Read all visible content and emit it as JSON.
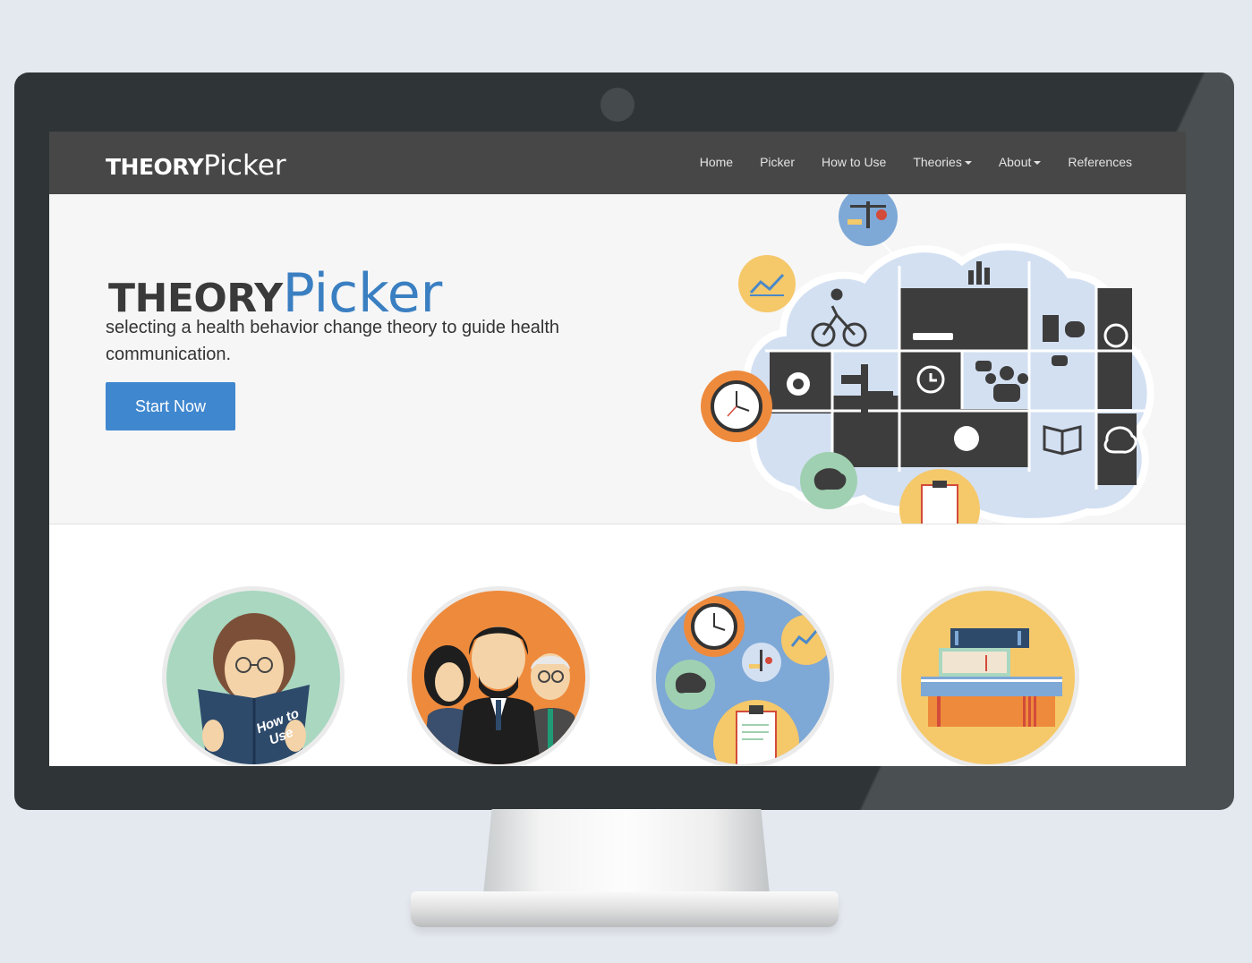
{
  "brand": {
    "part1": "THEORY",
    "part2": "Picker"
  },
  "nav": {
    "items": [
      {
        "label": "Home",
        "dropdown": false
      },
      {
        "label": "Picker",
        "dropdown": false
      },
      {
        "label": "How to Use",
        "dropdown": false
      },
      {
        "label": "Theories",
        "dropdown": true
      },
      {
        "label": "About",
        "dropdown": true
      },
      {
        "label": "References",
        "dropdown": false
      }
    ]
  },
  "hero": {
    "title_part1": "THEORY",
    "title_part2": "Picker",
    "subtitle": "selecting a health behavior change theory to guide health communication.",
    "cta_label": "Start Now"
  },
  "illustration": {
    "book_text_line1": "How to",
    "book_text_line2": "Use"
  },
  "colors": {
    "navbar": "#474747",
    "accent": "#3a7fc1",
    "button": "#3f87cf",
    "hero_bg": "#f6f6f6",
    "monitor": "#2f3537"
  }
}
